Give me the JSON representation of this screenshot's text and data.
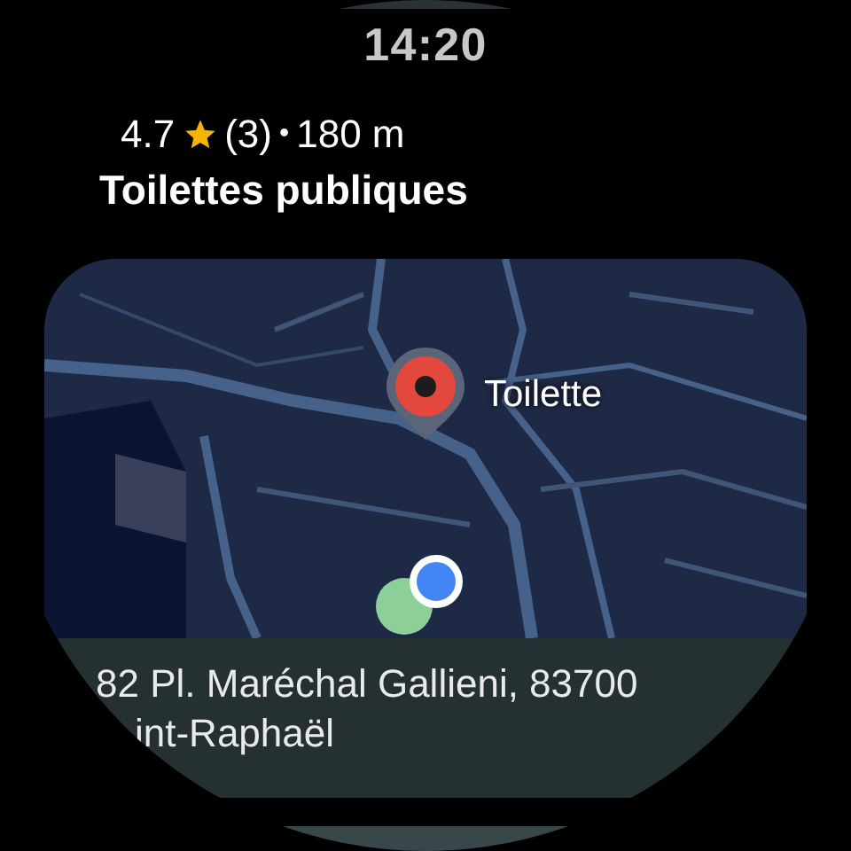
{
  "status": {
    "time": "14:20"
  },
  "place": {
    "rating": "4.7",
    "reviews": "(3)",
    "separator": "•",
    "distance": "180 m",
    "name": "Toilettes publiques"
  },
  "map": {
    "marker_label": "Toilette"
  },
  "address": {
    "line_1": "82 Pl. Maréchal Gallieni, 83700",
    "line_2": "int-Raphaël"
  }
}
